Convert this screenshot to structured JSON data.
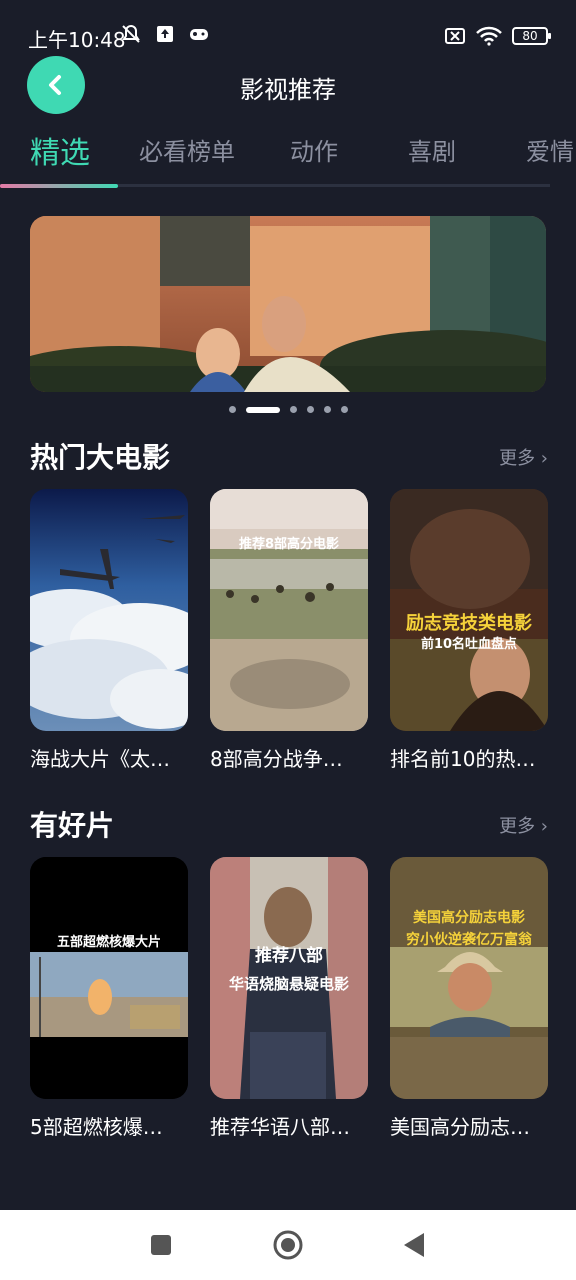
{
  "status": {
    "time": "上午10:48",
    "battery": "80"
  },
  "header": {
    "title": "影视推荐"
  },
  "tabs": [
    "精选",
    "必看榜单",
    "动作",
    "喜剧",
    "爱情"
  ],
  "banner": {
    "slides": 6,
    "active_slide": 2
  },
  "sections": [
    {
      "title": "热门大电影",
      "more": "更多 ›",
      "cards": [
        {
          "title": "海战大片《太…",
          "overlay": "",
          "sub": ""
        },
        {
          "title": "8部高分战争…",
          "overlay": "推荐8部高分电影",
          "sub": ""
        },
        {
          "title": "排名前10的热…",
          "overlay": "励志竞技类电影",
          "sub": "前10名吐血盘点"
        }
      ]
    },
    {
      "title": "有好片",
      "more": "更多 ›",
      "cards": [
        {
          "title": "5部超燃核爆…",
          "overlay": "五部超燃核爆大片",
          "sub": ""
        },
        {
          "title": "推荐华语八部…",
          "overlay": "推荐八部",
          "sub": "华语烧脑悬疑电影"
        },
        {
          "title": "美国高分励志…",
          "overlay": "美国高分励志电影",
          "sub": "穷小伙逆袭亿万富翁"
        }
      ]
    }
  ],
  "colors": {
    "accent": "#3fd9b3",
    "background": "#1a1d29",
    "tab_inactive": "#8c90a0"
  }
}
